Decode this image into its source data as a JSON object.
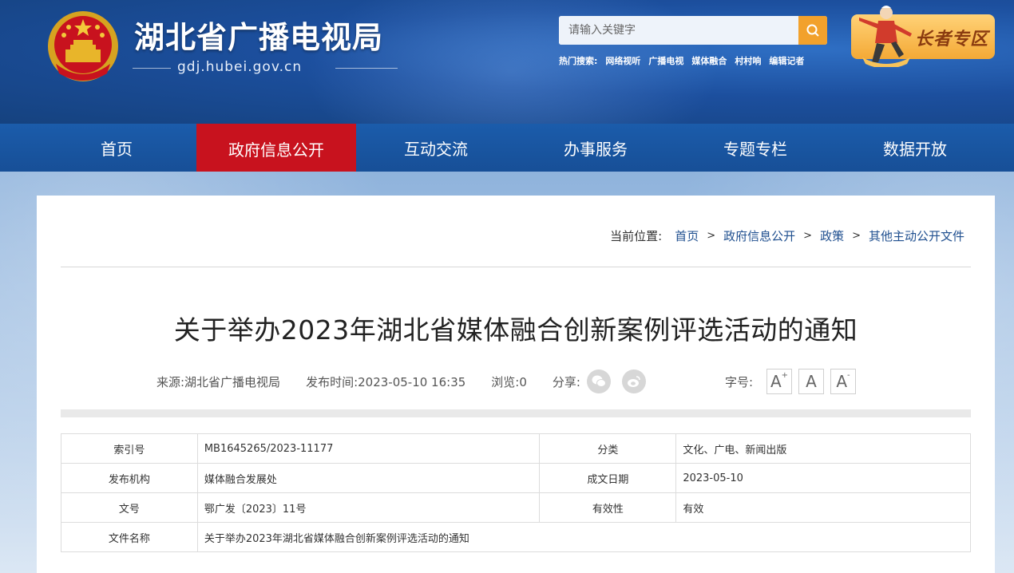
{
  "header": {
    "site_title": "湖北省广播电视局",
    "site_domain": "gdj.hubei.gov.cn",
    "search_placeholder": "请输入关键字",
    "hot_search_label": "热门搜索:",
    "hot_search_items": [
      "网络视听",
      "广播电视",
      "媒体融合",
      "村村响",
      "编辑记者"
    ],
    "elder_label": "长者专区"
  },
  "nav": {
    "items": [
      "首页",
      "政府信息公开",
      "互动交流",
      "办事服务",
      "专题专栏",
      "数据开放"
    ],
    "active_index": 1
  },
  "breadcrumb": {
    "lead": "当前位置:",
    "items": [
      "首页",
      "政府信息公开",
      "政策",
      "其他主动公开文件"
    ],
    "separator": ">"
  },
  "article": {
    "title": "关于举办2023年湖北省媒体融合创新案例评选活动的通知",
    "source": "来源:湖北省广播电视局",
    "publish_time": "发布时间:2023-05-10 16:35",
    "views": "浏览:0",
    "share_label": "分享:",
    "font_size_label": "字号:",
    "font_buttons": [
      "A",
      "A",
      "A"
    ]
  },
  "info_table": {
    "rows": [
      {
        "k1": "索引号",
        "v1": "MB1645265/2023-11177",
        "k2": "分类",
        "v2": "文化、广电、新闻出版"
      },
      {
        "k1": "发布机构",
        "v1": "媒体融合发展处",
        "k2": "成文日期",
        "v2": "2023-05-10"
      },
      {
        "k1": "文号",
        "v1": "鄂广发〔2023〕11号",
        "k2": "有效性",
        "v2": "有效"
      }
    ],
    "last_row": {
      "k": "文件名称",
      "v": "关于举办2023年湖北省媒体融合创新案例评选活动的通知"
    }
  },
  "colors": {
    "header_blue": "#1c4f9e",
    "nav_blue": "#1b5cab",
    "active_red": "#c8121e",
    "search_orange": "#f2a12c"
  }
}
